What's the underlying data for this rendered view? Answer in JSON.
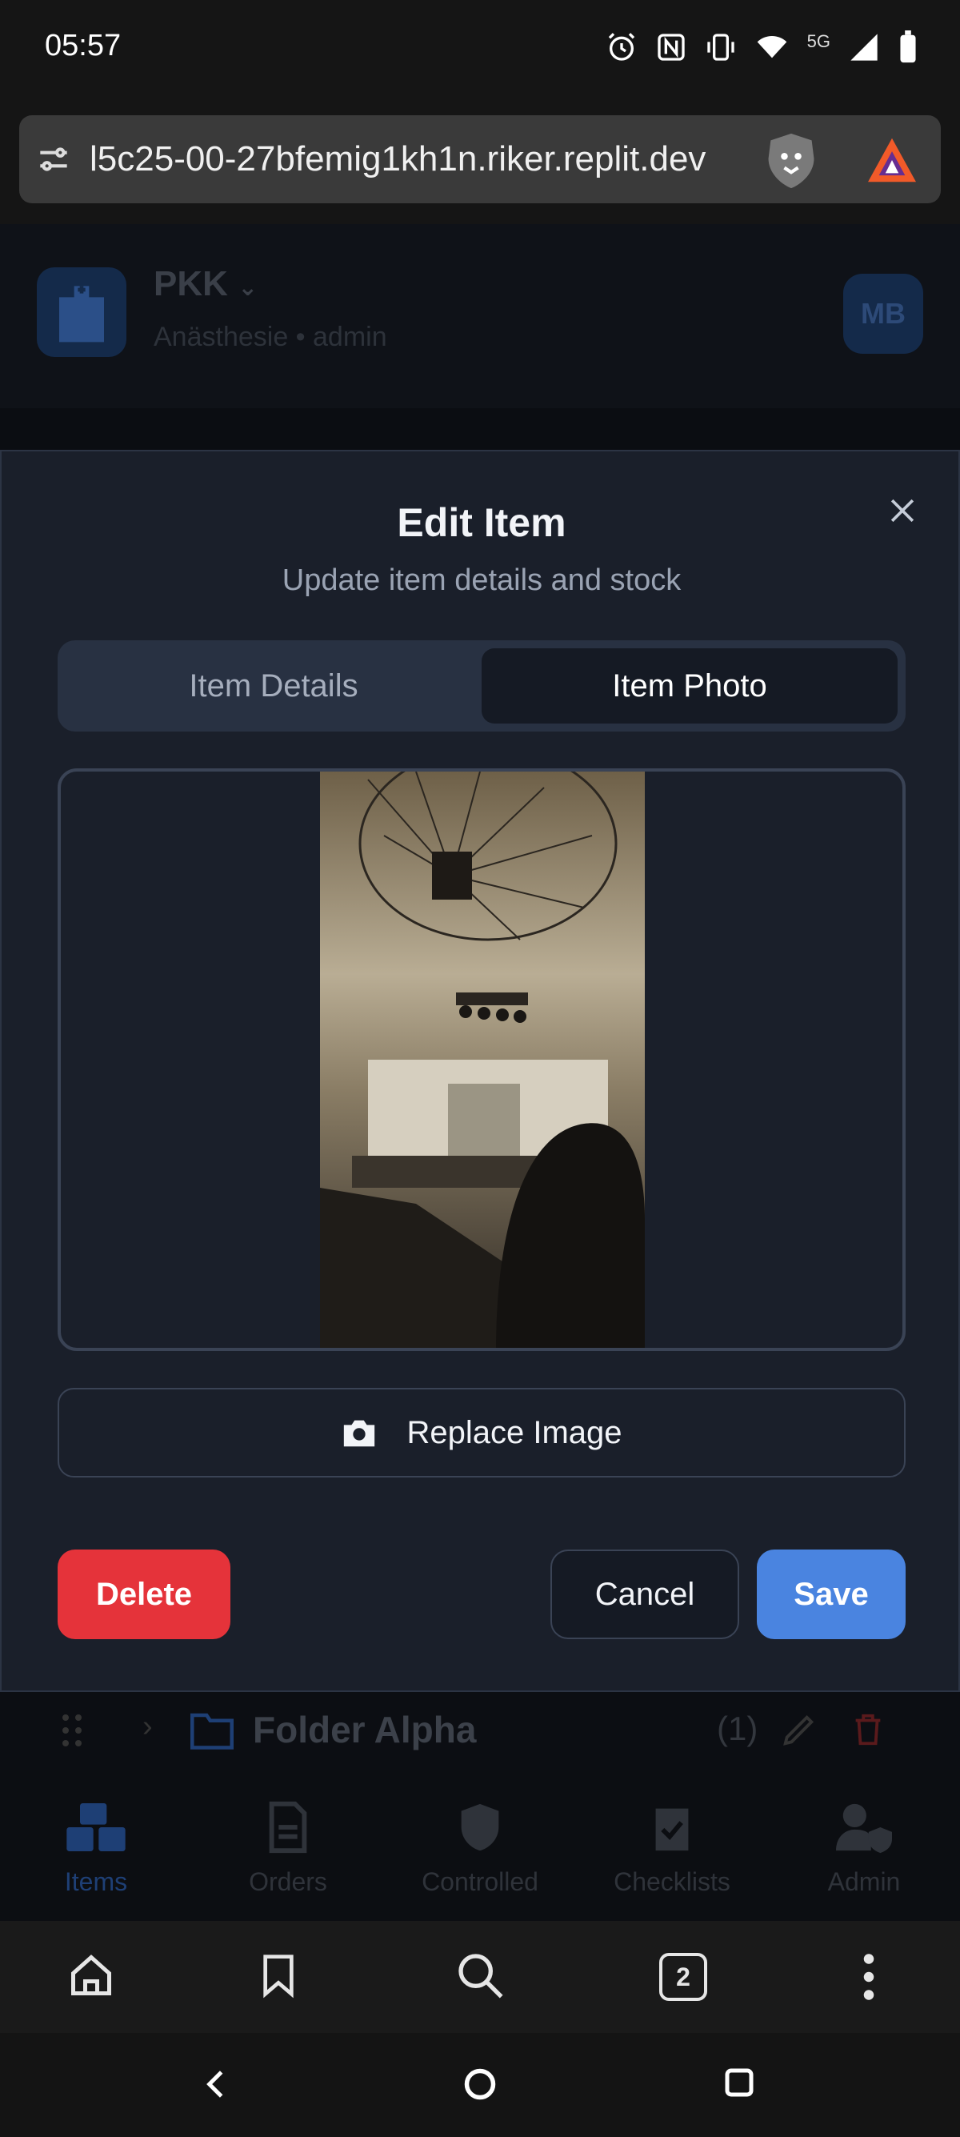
{
  "status_bar": {
    "time": "05:57",
    "network": "5G"
  },
  "browser": {
    "url": "l5c25-00-27bfemig1kh1n.riker.replit.dev",
    "tab_count": "2"
  },
  "app": {
    "org_name": "PKK",
    "org_sub": "Anästhesie • admin",
    "avatar_initials": "MB",
    "folder_name": "Folder Alpha",
    "folder_count": "(1)",
    "nav": [
      {
        "label": "Items",
        "icon": "boxes-icon"
      },
      {
        "label": "Orders",
        "icon": "document-icon"
      },
      {
        "label": "Controlled",
        "icon": "shield-icon"
      },
      {
        "label": "Checklists",
        "icon": "clipboard-check-icon"
      },
      {
        "label": "Admin",
        "icon": "user-shield-icon"
      }
    ]
  },
  "dialog": {
    "title": "Edit Item",
    "subtitle": "Update item details and stock",
    "tab_details": "Item Details",
    "tab_photo": "Item Photo",
    "replace_label": "Replace Image",
    "delete_label": "Delete",
    "cancel_label": "Cancel",
    "save_label": "Save"
  },
  "colors": {
    "accent": "#4a84e0",
    "danger": "#e5333a",
    "dialog_bg": "#1a1f2a"
  }
}
